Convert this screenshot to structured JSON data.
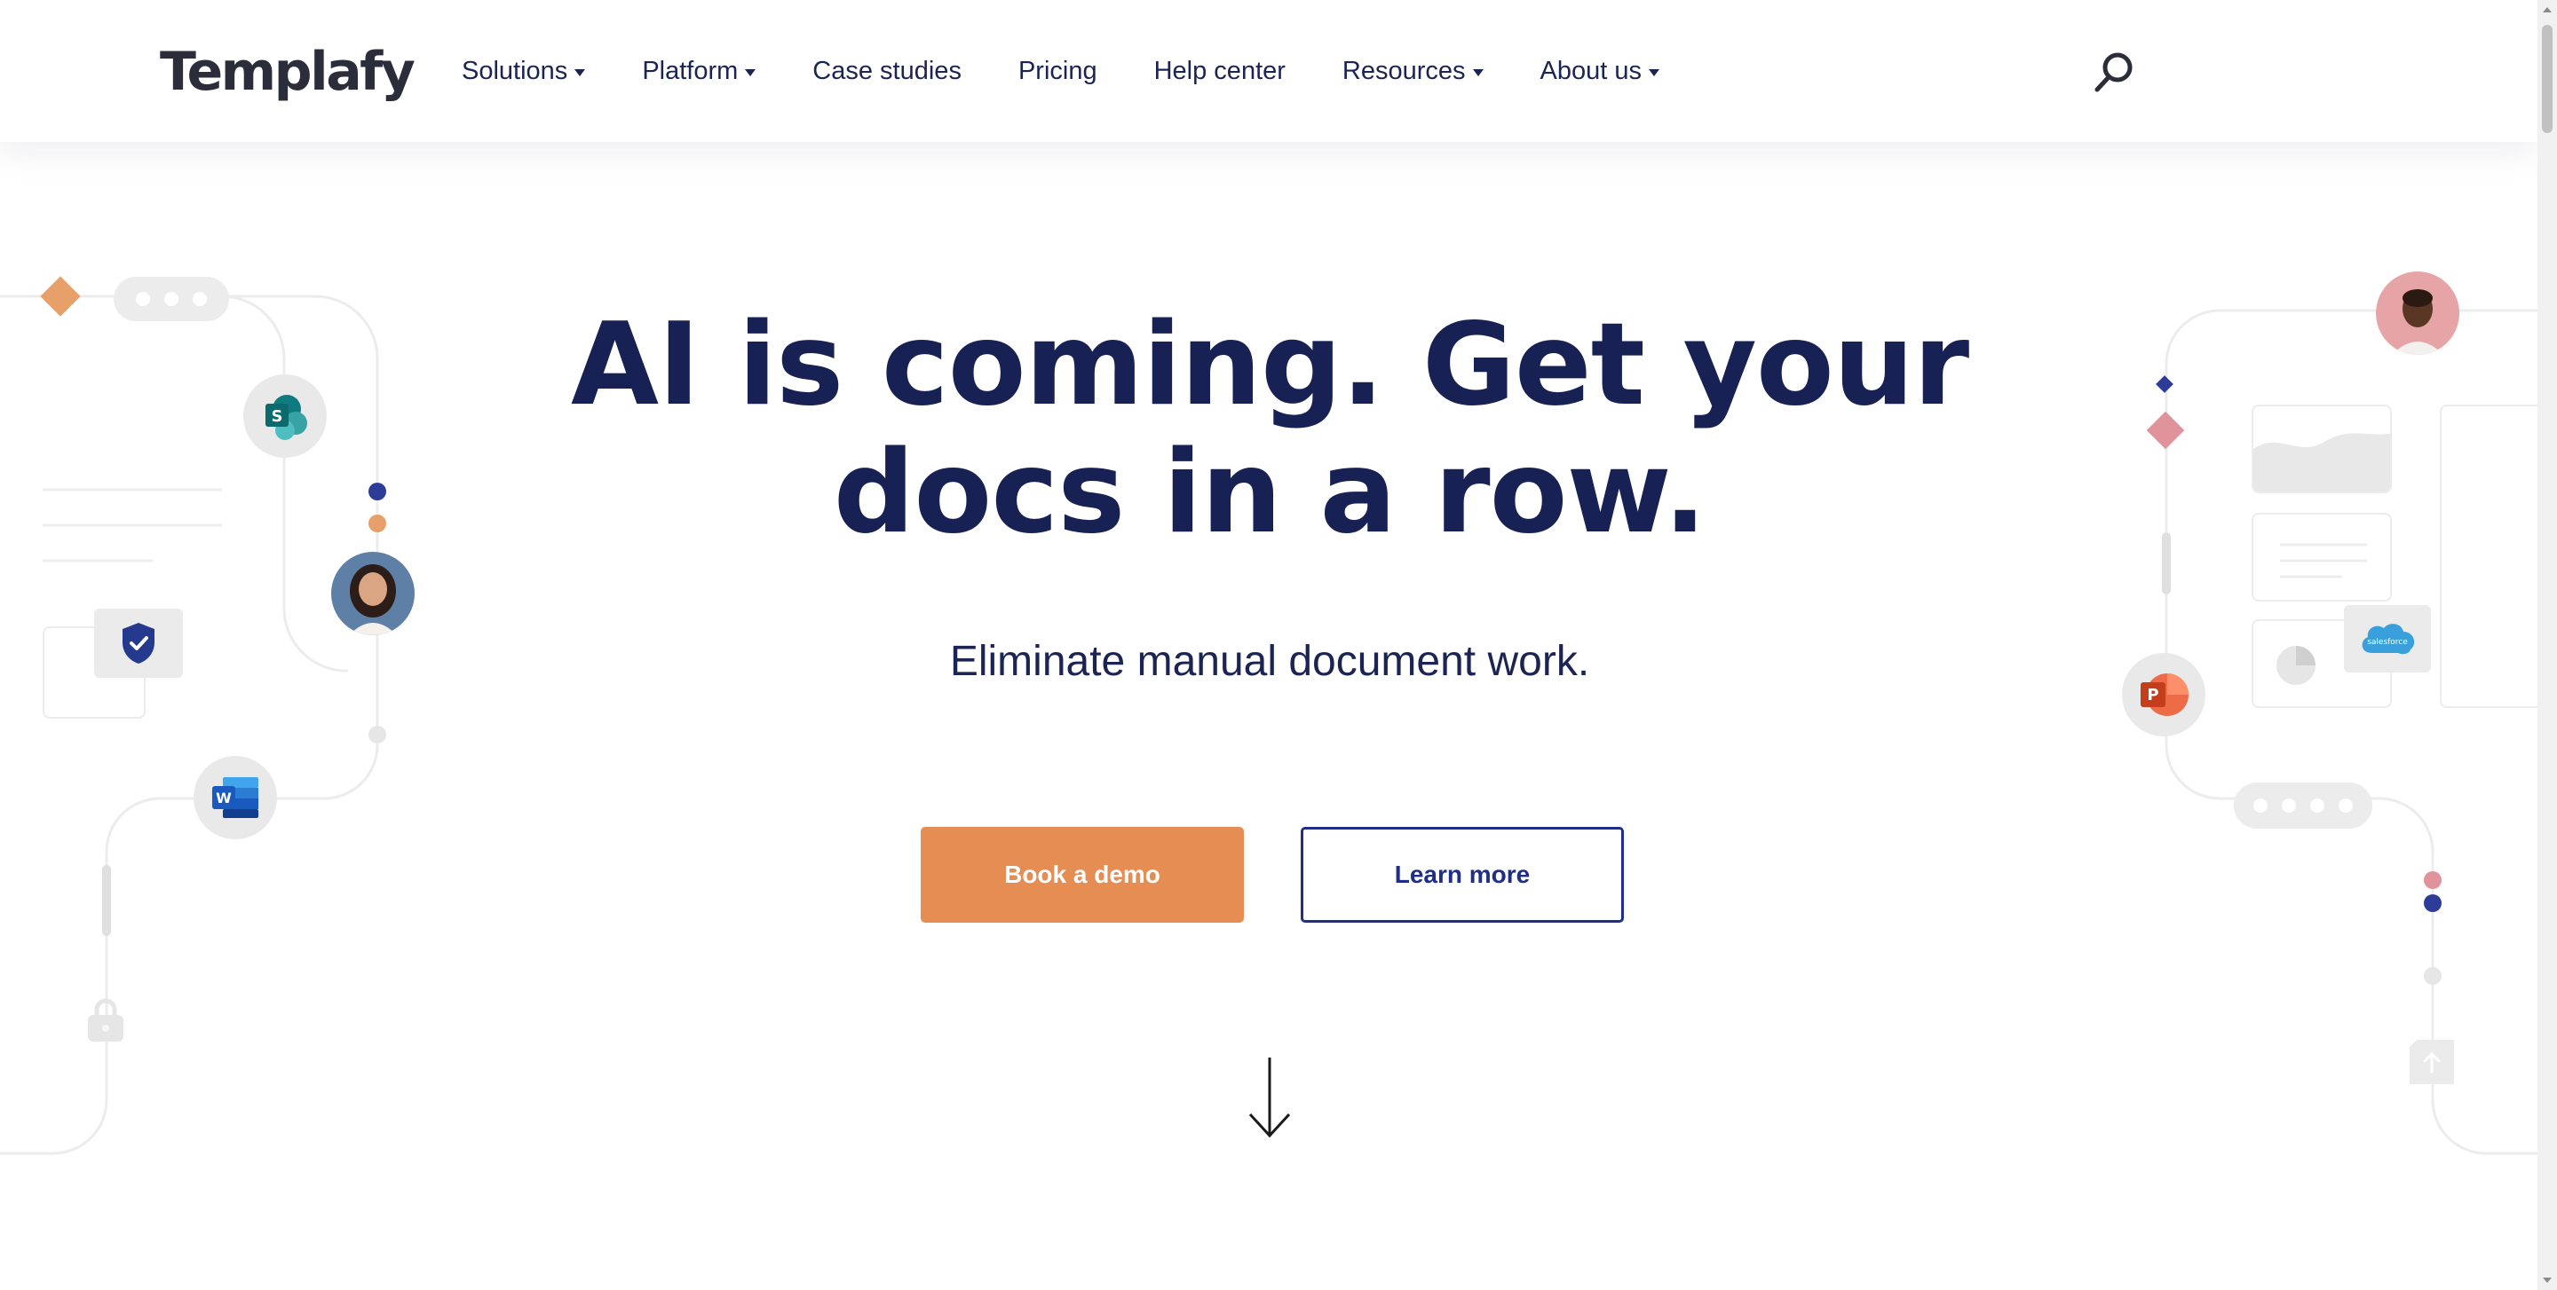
{
  "header": {
    "logo_text": "Templafy",
    "nav": [
      {
        "label": "Solutions",
        "dropdown": true
      },
      {
        "label": "Platform",
        "dropdown": true
      },
      {
        "label": "Case studies",
        "dropdown": false
      },
      {
        "label": "Pricing",
        "dropdown": false
      },
      {
        "label": "Help center",
        "dropdown": false
      },
      {
        "label": "Resources",
        "dropdown": true
      },
      {
        "label": "About us",
        "dropdown": true
      }
    ],
    "search_icon": "search-icon"
  },
  "hero": {
    "title_line1": "AI is coming. Get your",
    "title_line2": "docs in a row.",
    "subtitle": "Eliminate manual document work.",
    "primary_button": "Book a demo",
    "secondary_button": "Learn more",
    "scroll_icon": "arrow-down-icon"
  },
  "decorations": {
    "left_icons": [
      "sharepoint-icon",
      "shield-check-icon",
      "word-icon",
      "lock-icon"
    ],
    "right_icons": [
      "powerpoint-icon",
      "salesforce-icon",
      "upload-icon"
    ],
    "salesforce_text": "salesforce"
  },
  "colors": {
    "navy": "#172154",
    "accent_orange": "#e58d53",
    "button_outline": "#1f2e86",
    "pink": "#e0939b",
    "blue_dot": "#2c3c97"
  }
}
